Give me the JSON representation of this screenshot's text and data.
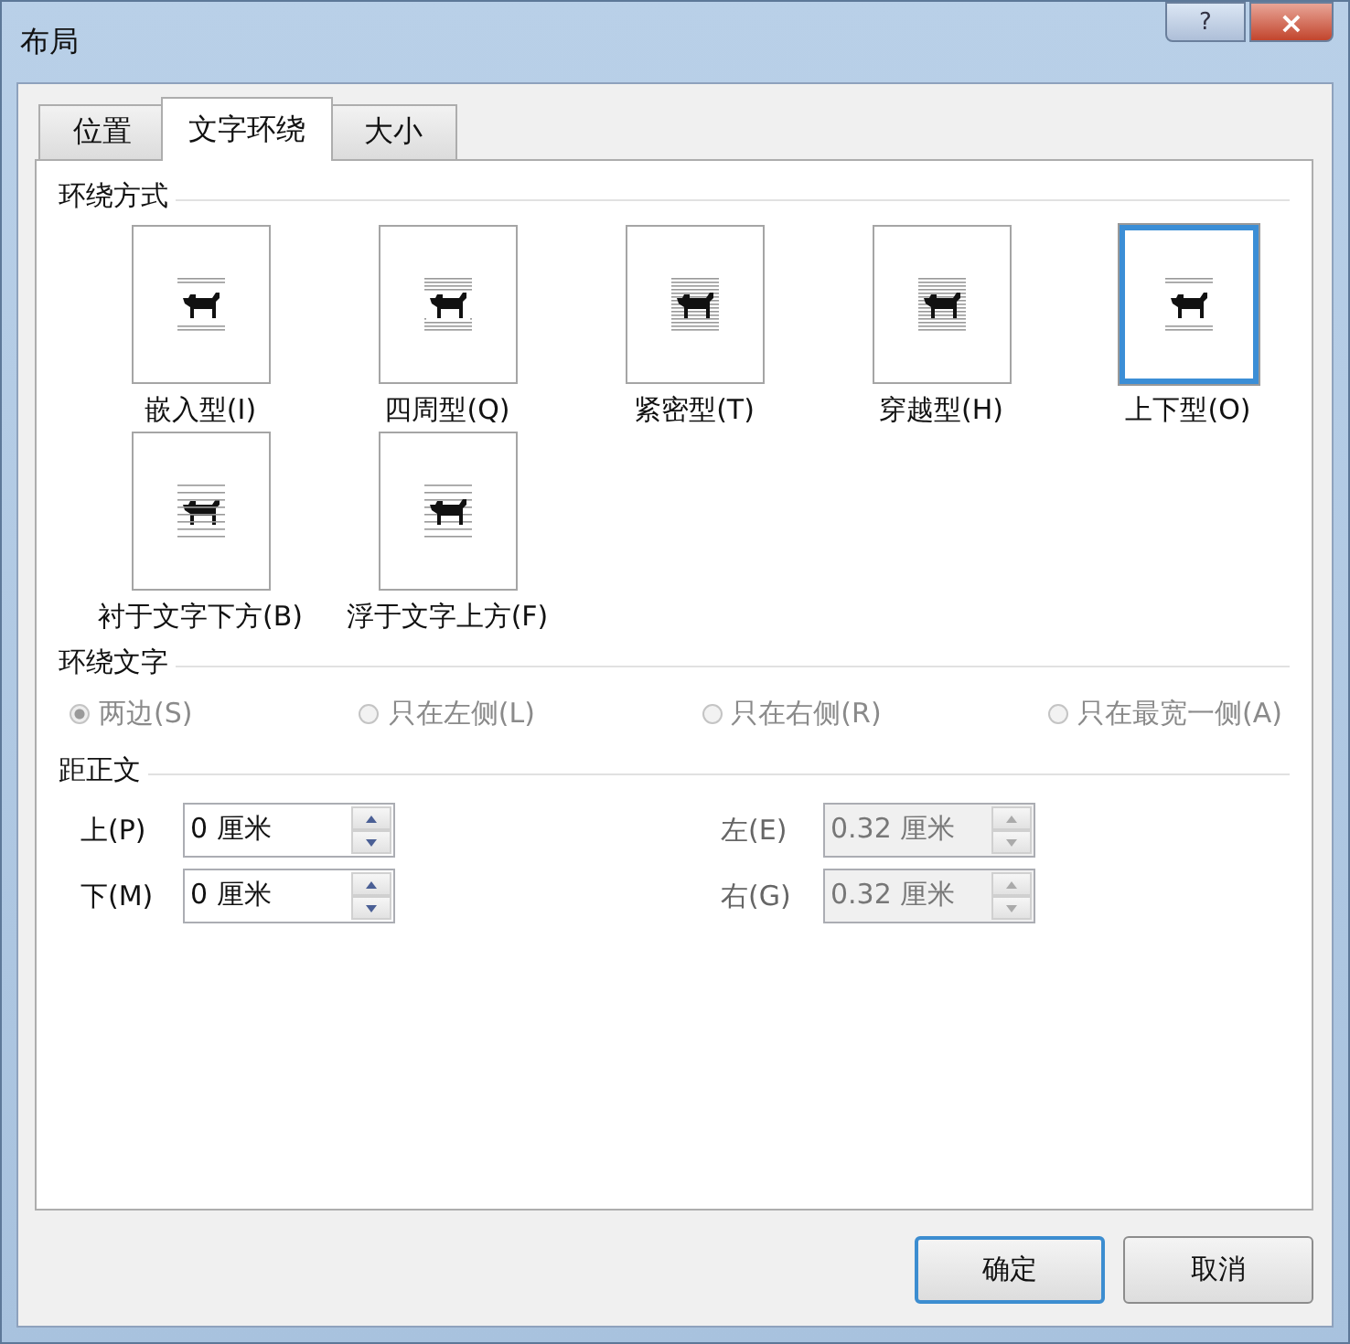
{
  "window": {
    "title": "布局",
    "help": "?",
    "close": "×"
  },
  "tabs": [
    {
      "label": "位置",
      "selected": false
    },
    {
      "label": "文字环绕",
      "selected": true
    },
    {
      "label": "大小",
      "selected": false
    }
  ],
  "wrap_style": {
    "heading": "环绕方式",
    "options": [
      {
        "label": "嵌入型(I)",
        "kind": "inline",
        "selected": false
      },
      {
        "label": "四周型(Q)",
        "kind": "square",
        "selected": false
      },
      {
        "label": "紧密型(T)",
        "kind": "tight",
        "selected": false
      },
      {
        "label": "穿越型(H)",
        "kind": "through",
        "selected": false
      },
      {
        "label": "上下型(O)",
        "kind": "topbottom",
        "selected": true
      },
      {
        "label": "衬于文字下方(B)",
        "kind": "behind",
        "selected": false
      },
      {
        "label": "浮于文字上方(F)",
        "kind": "front",
        "selected": false
      }
    ]
  },
  "wrap_text": {
    "heading": "环绕文字",
    "options": [
      {
        "label": "两边(S)",
        "selected": true,
        "disabled": true
      },
      {
        "label": "只在左侧(L)",
        "selected": false,
        "disabled": true
      },
      {
        "label": "只在右侧(R)",
        "selected": false,
        "disabled": true
      },
      {
        "label": "只在最宽一侧(A)",
        "selected": false,
        "disabled": true
      }
    ]
  },
  "distance": {
    "heading": "距正文",
    "fields": [
      {
        "label": "上(P)",
        "value": "0 厘米",
        "disabled": false
      },
      {
        "label": "左(E)",
        "value": "0.32 厘米",
        "disabled": true
      },
      {
        "label": "下(M)",
        "value": "0 厘米",
        "disabled": false
      },
      {
        "label": "右(G)",
        "value": "0.32 厘米",
        "disabled": true
      }
    ]
  },
  "buttons": [
    {
      "label": "确定",
      "kind": "default"
    },
    {
      "label": "取消",
      "kind": "normal"
    }
  ]
}
